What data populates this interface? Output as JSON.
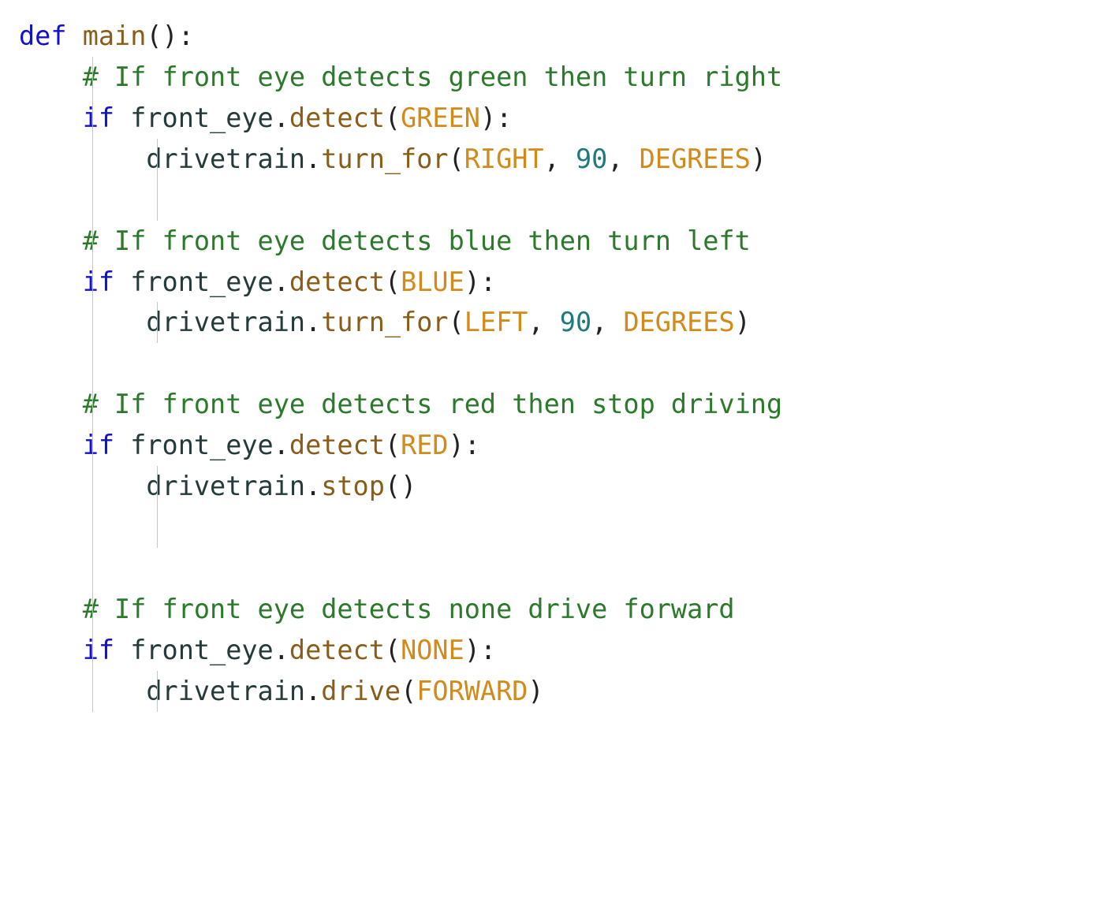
{
  "code": {
    "lines": [
      {
        "indent": 0,
        "tokens": [
          {
            "cls": "tok-kw",
            "bind": "t.def"
          },
          {
            "cls": "tok-pn",
            "bind": "t.sp"
          },
          {
            "cls": "tok-fn",
            "bind": "t.main"
          },
          {
            "cls": "tok-pn",
            "bind": "t.lp"
          },
          {
            "cls": "tok-pn",
            "bind": "t.rp"
          },
          {
            "cls": "tok-pn",
            "bind": "t.colon"
          }
        ]
      },
      {
        "indent": 1,
        "tokens": [
          {
            "cls": "tok-cm",
            "bind": "comments.c1"
          }
        ]
      },
      {
        "indent": 1,
        "tokens": [
          {
            "cls": "tok-kw",
            "bind": "t.if_"
          },
          {
            "cls": "tok-pn",
            "bind": "t.sp"
          },
          {
            "cls": "tok-id",
            "bind": "t.front_eye"
          },
          {
            "cls": "tok-pn",
            "bind": "t.dot"
          },
          {
            "cls": "tok-fn",
            "bind": "t.detect"
          },
          {
            "cls": "tok-pn",
            "bind": "t.lp"
          },
          {
            "cls": "tok-const",
            "bind": "t.GREEN"
          },
          {
            "cls": "tok-pn",
            "bind": "t.rp"
          },
          {
            "cls": "tok-pn",
            "bind": "t.colon"
          }
        ]
      },
      {
        "indent": 2,
        "tokens": [
          {
            "cls": "tok-id",
            "bind": "t.drivetrain"
          },
          {
            "cls": "tok-pn",
            "bind": "t.dot"
          },
          {
            "cls": "tok-fn",
            "bind": "t.turn_for"
          },
          {
            "cls": "tok-pn",
            "bind": "t.lp"
          },
          {
            "cls": "tok-const",
            "bind": "t.RIGHT"
          },
          {
            "cls": "tok-pn",
            "bind": "t.comma_sp"
          },
          {
            "cls": "tok-num",
            "bind": "t.n90"
          },
          {
            "cls": "tok-pn",
            "bind": "t.comma_sp"
          },
          {
            "cls": "tok-const",
            "bind": "t.DEGREES"
          },
          {
            "cls": "tok-pn",
            "bind": "t.rp"
          }
        ]
      },
      {
        "indent": 2,
        "tokens": []
      },
      {
        "indent": 1,
        "tokens": [
          {
            "cls": "tok-cm",
            "bind": "comments.c2"
          }
        ]
      },
      {
        "indent": 1,
        "tokens": [
          {
            "cls": "tok-kw",
            "bind": "t.if_"
          },
          {
            "cls": "tok-pn",
            "bind": "t.sp"
          },
          {
            "cls": "tok-id",
            "bind": "t.front_eye"
          },
          {
            "cls": "tok-pn",
            "bind": "t.dot"
          },
          {
            "cls": "tok-fn",
            "bind": "t.detect"
          },
          {
            "cls": "tok-pn",
            "bind": "t.lp"
          },
          {
            "cls": "tok-const",
            "bind": "t.BLUE"
          },
          {
            "cls": "tok-pn",
            "bind": "t.rp"
          },
          {
            "cls": "tok-pn",
            "bind": "t.colon"
          }
        ]
      },
      {
        "indent": 2,
        "tokens": [
          {
            "cls": "tok-id",
            "bind": "t.drivetrain"
          },
          {
            "cls": "tok-pn",
            "bind": "t.dot"
          },
          {
            "cls": "tok-fn",
            "bind": "t.turn_for"
          },
          {
            "cls": "tok-pn",
            "bind": "t.lp"
          },
          {
            "cls": "tok-const",
            "bind": "t.LEFT"
          },
          {
            "cls": "tok-pn",
            "bind": "t.comma_sp"
          },
          {
            "cls": "tok-num",
            "bind": "t.n90"
          },
          {
            "cls": "tok-pn",
            "bind": "t.comma_sp"
          },
          {
            "cls": "tok-const",
            "bind": "t.DEGREES"
          },
          {
            "cls": "tok-pn",
            "bind": "t.rp"
          }
        ]
      },
      {
        "indent": 1,
        "tokens": []
      },
      {
        "indent": 1,
        "tokens": [
          {
            "cls": "tok-cm",
            "bind": "comments.c3"
          }
        ]
      },
      {
        "indent": 1,
        "tokens": [
          {
            "cls": "tok-kw",
            "bind": "t.if_"
          },
          {
            "cls": "tok-pn",
            "bind": "t.sp"
          },
          {
            "cls": "tok-id",
            "bind": "t.front_eye"
          },
          {
            "cls": "tok-pn",
            "bind": "t.dot"
          },
          {
            "cls": "tok-fn",
            "bind": "t.detect"
          },
          {
            "cls": "tok-pn",
            "bind": "t.lp"
          },
          {
            "cls": "tok-const",
            "bind": "t.RED"
          },
          {
            "cls": "tok-pn",
            "bind": "t.rp"
          },
          {
            "cls": "tok-pn",
            "bind": "t.colon"
          }
        ]
      },
      {
        "indent": 2,
        "tokens": [
          {
            "cls": "tok-id",
            "bind": "t.drivetrain"
          },
          {
            "cls": "tok-pn",
            "bind": "t.dot"
          },
          {
            "cls": "tok-fn",
            "bind": "t.stop"
          },
          {
            "cls": "tok-pn",
            "bind": "t.lp"
          },
          {
            "cls": "tok-pn",
            "bind": "t.rp"
          }
        ]
      },
      {
        "indent": 2,
        "tokens": []
      },
      {
        "indent": 1,
        "tokens": []
      },
      {
        "indent": 1,
        "tokens": [
          {
            "cls": "tok-cm",
            "bind": "comments.c4"
          }
        ]
      },
      {
        "indent": 1,
        "tokens": [
          {
            "cls": "tok-kw",
            "bind": "t.if_"
          },
          {
            "cls": "tok-pn",
            "bind": "t.sp"
          },
          {
            "cls": "tok-id",
            "bind": "t.front_eye"
          },
          {
            "cls": "tok-pn",
            "bind": "t.dot"
          },
          {
            "cls": "tok-fn",
            "bind": "t.detect"
          },
          {
            "cls": "tok-pn",
            "bind": "t.lp"
          },
          {
            "cls": "tok-const",
            "bind": "t.NONE"
          },
          {
            "cls": "tok-pn",
            "bind": "t.rp"
          },
          {
            "cls": "tok-pn",
            "bind": "t.colon"
          }
        ]
      },
      {
        "indent": 2,
        "tokens": [
          {
            "cls": "tok-id",
            "bind": "t.drivetrain"
          },
          {
            "cls": "tok-pn",
            "bind": "t.dot"
          },
          {
            "cls": "tok-fn",
            "bind": "t.drive"
          },
          {
            "cls": "tok-pn",
            "bind": "t.lp"
          },
          {
            "cls": "tok-const",
            "bind": "t.FORWARD"
          },
          {
            "cls": "tok-pn",
            "bind": "t.rp"
          }
        ]
      }
    ]
  },
  "comments": {
    "c1": "# If front eye detects green then turn right",
    "c2": "# If front eye detects blue then turn left",
    "c3": "# If front eye detects red then stop driving",
    "c4": "# If front eye detects none drive forward"
  },
  "t": {
    "def": "def",
    "main": "main",
    "if_": "if",
    "front_eye": "front_eye",
    "detect": "detect",
    "drivetrain": "drivetrain",
    "turn_for": "turn_for",
    "stop": "stop",
    "drive": "drive",
    "GREEN": "GREEN",
    "BLUE": "BLUE",
    "RED": "RED",
    "NONE": "NONE",
    "RIGHT": "RIGHT",
    "LEFT": "LEFT",
    "DEGREES": "DEGREES",
    "FORWARD": "FORWARD",
    "n90": "90",
    "lp": "(",
    "rp": ")",
    "colon": ":",
    "dot": ".",
    "comma_sp": ", ",
    "sp": " "
  },
  "layout": {
    "indent_unit": "    "
  }
}
